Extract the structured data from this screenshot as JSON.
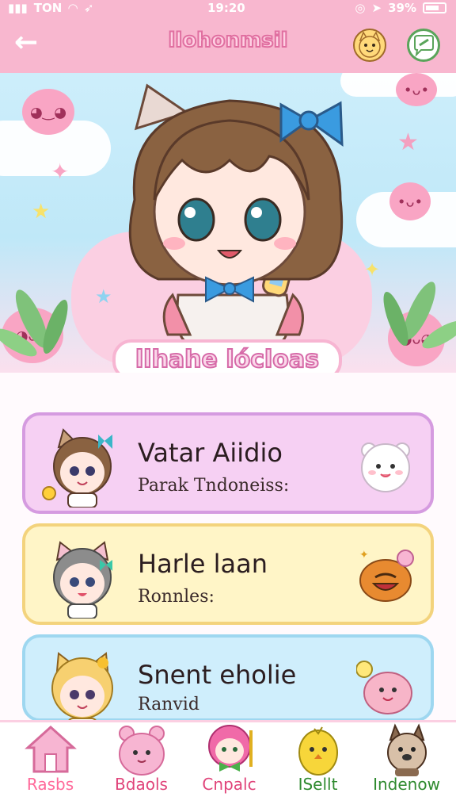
{
  "status_bar": {
    "carrier": "TON",
    "time": "19:20",
    "battery": "39%"
  },
  "header": {
    "back_icon": "arrow-left-icon",
    "title": "llohonmsil",
    "cat_icon": "cat-face-icon",
    "chat_icon": "chat-bubble-icon"
  },
  "hero": {
    "title": "llhahe lócloas",
    "character_icon": "anime-girl-character"
  },
  "cards": [
    {
      "title": "Vatar Aiidio",
      "subtitle": "Parak Tndoneiss:",
      "color": "#f6d0f3",
      "border": "#d59be0",
      "avatar": "cat-girl-brown-hair",
      "mascot": "white-bear-mascot"
    },
    {
      "title": "Harle laan",
      "subtitle": "Ronnles:",
      "color": "#fff5c7",
      "border": "#f3d37d",
      "avatar": "cat-girl-gray-hair",
      "mascot": "orange-donut-mascot"
    },
    {
      "title": "Snent eholie",
      "subtitle": "Ranvid",
      "color": "#cfeefc",
      "border": "#9ed7f0",
      "avatar": "cat-girl-blonde-hair",
      "mascot": "pink-blob-mascot"
    }
  ],
  "bottom_nav": [
    {
      "label": "Rasbs",
      "icon": "house-icon",
      "color": "#ff6a9a"
    },
    {
      "label": "Bdaols",
      "icon": "pink-bear-icon",
      "color": "#e0447a"
    },
    {
      "label": "Cnpalc",
      "icon": "pink-hair-character-icon",
      "color": "#e0447a"
    },
    {
      "label": "ISellt",
      "icon": "yellow-chick-icon",
      "color": "#2f8a2f"
    },
    {
      "label": "Indenow",
      "icon": "dog-icon",
      "color": "#2f8a2f"
    }
  ]
}
